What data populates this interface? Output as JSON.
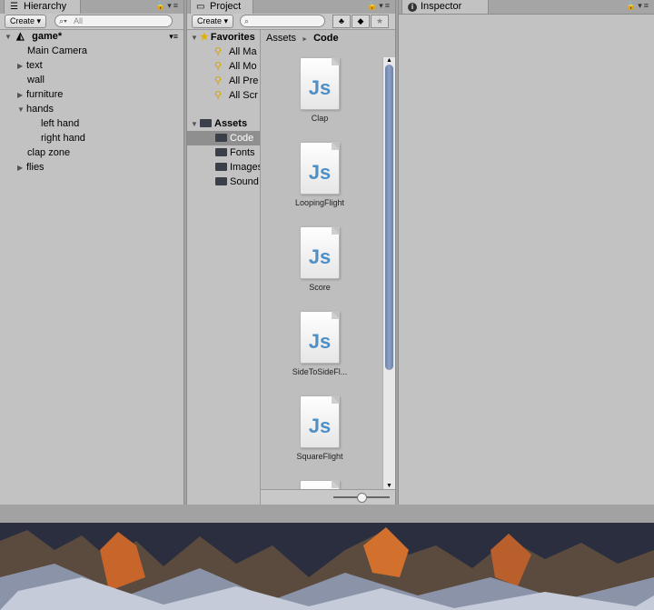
{
  "hierarchy": {
    "tab_label": "Hierarchy",
    "create_label": "Create ▾",
    "search_placeholder": "All",
    "scene": "game*",
    "items": [
      {
        "label": "Main Camera"
      },
      {
        "label": "text"
      },
      {
        "label": "wall"
      },
      {
        "label": "furniture"
      },
      {
        "label": "hands"
      },
      {
        "label": "left hand"
      },
      {
        "label": "right hand"
      },
      {
        "label": "clap zone"
      },
      {
        "label": "flies"
      }
    ]
  },
  "project": {
    "tab_label": "Project",
    "create_label": "Create ▾",
    "favorites": {
      "label": "Favorites",
      "items": [
        {
          "label": "All Ma"
        },
        {
          "label": "All Mo"
        },
        {
          "label": "All Pre"
        },
        {
          "label": "All Scr"
        }
      ]
    },
    "assets": {
      "label": "Assets",
      "folders": [
        {
          "label": "Code"
        },
        {
          "label": "Fonts"
        },
        {
          "label": "Images"
        },
        {
          "label": "Sound"
        }
      ]
    },
    "breadcrumb": {
      "root": "Assets",
      "separator": "►",
      "current": "Code"
    },
    "files": [
      {
        "label": "Clap"
      },
      {
        "label": "LoopingFlight"
      },
      {
        "label": "Score"
      },
      {
        "label": "SideToSideFl..."
      },
      {
        "label": "SquareFlight"
      }
    ],
    "icon_text": "Js",
    "zoom_level": 0.5
  },
  "inspector": {
    "tab_label": "Inspector",
    "info_icon": "i"
  }
}
